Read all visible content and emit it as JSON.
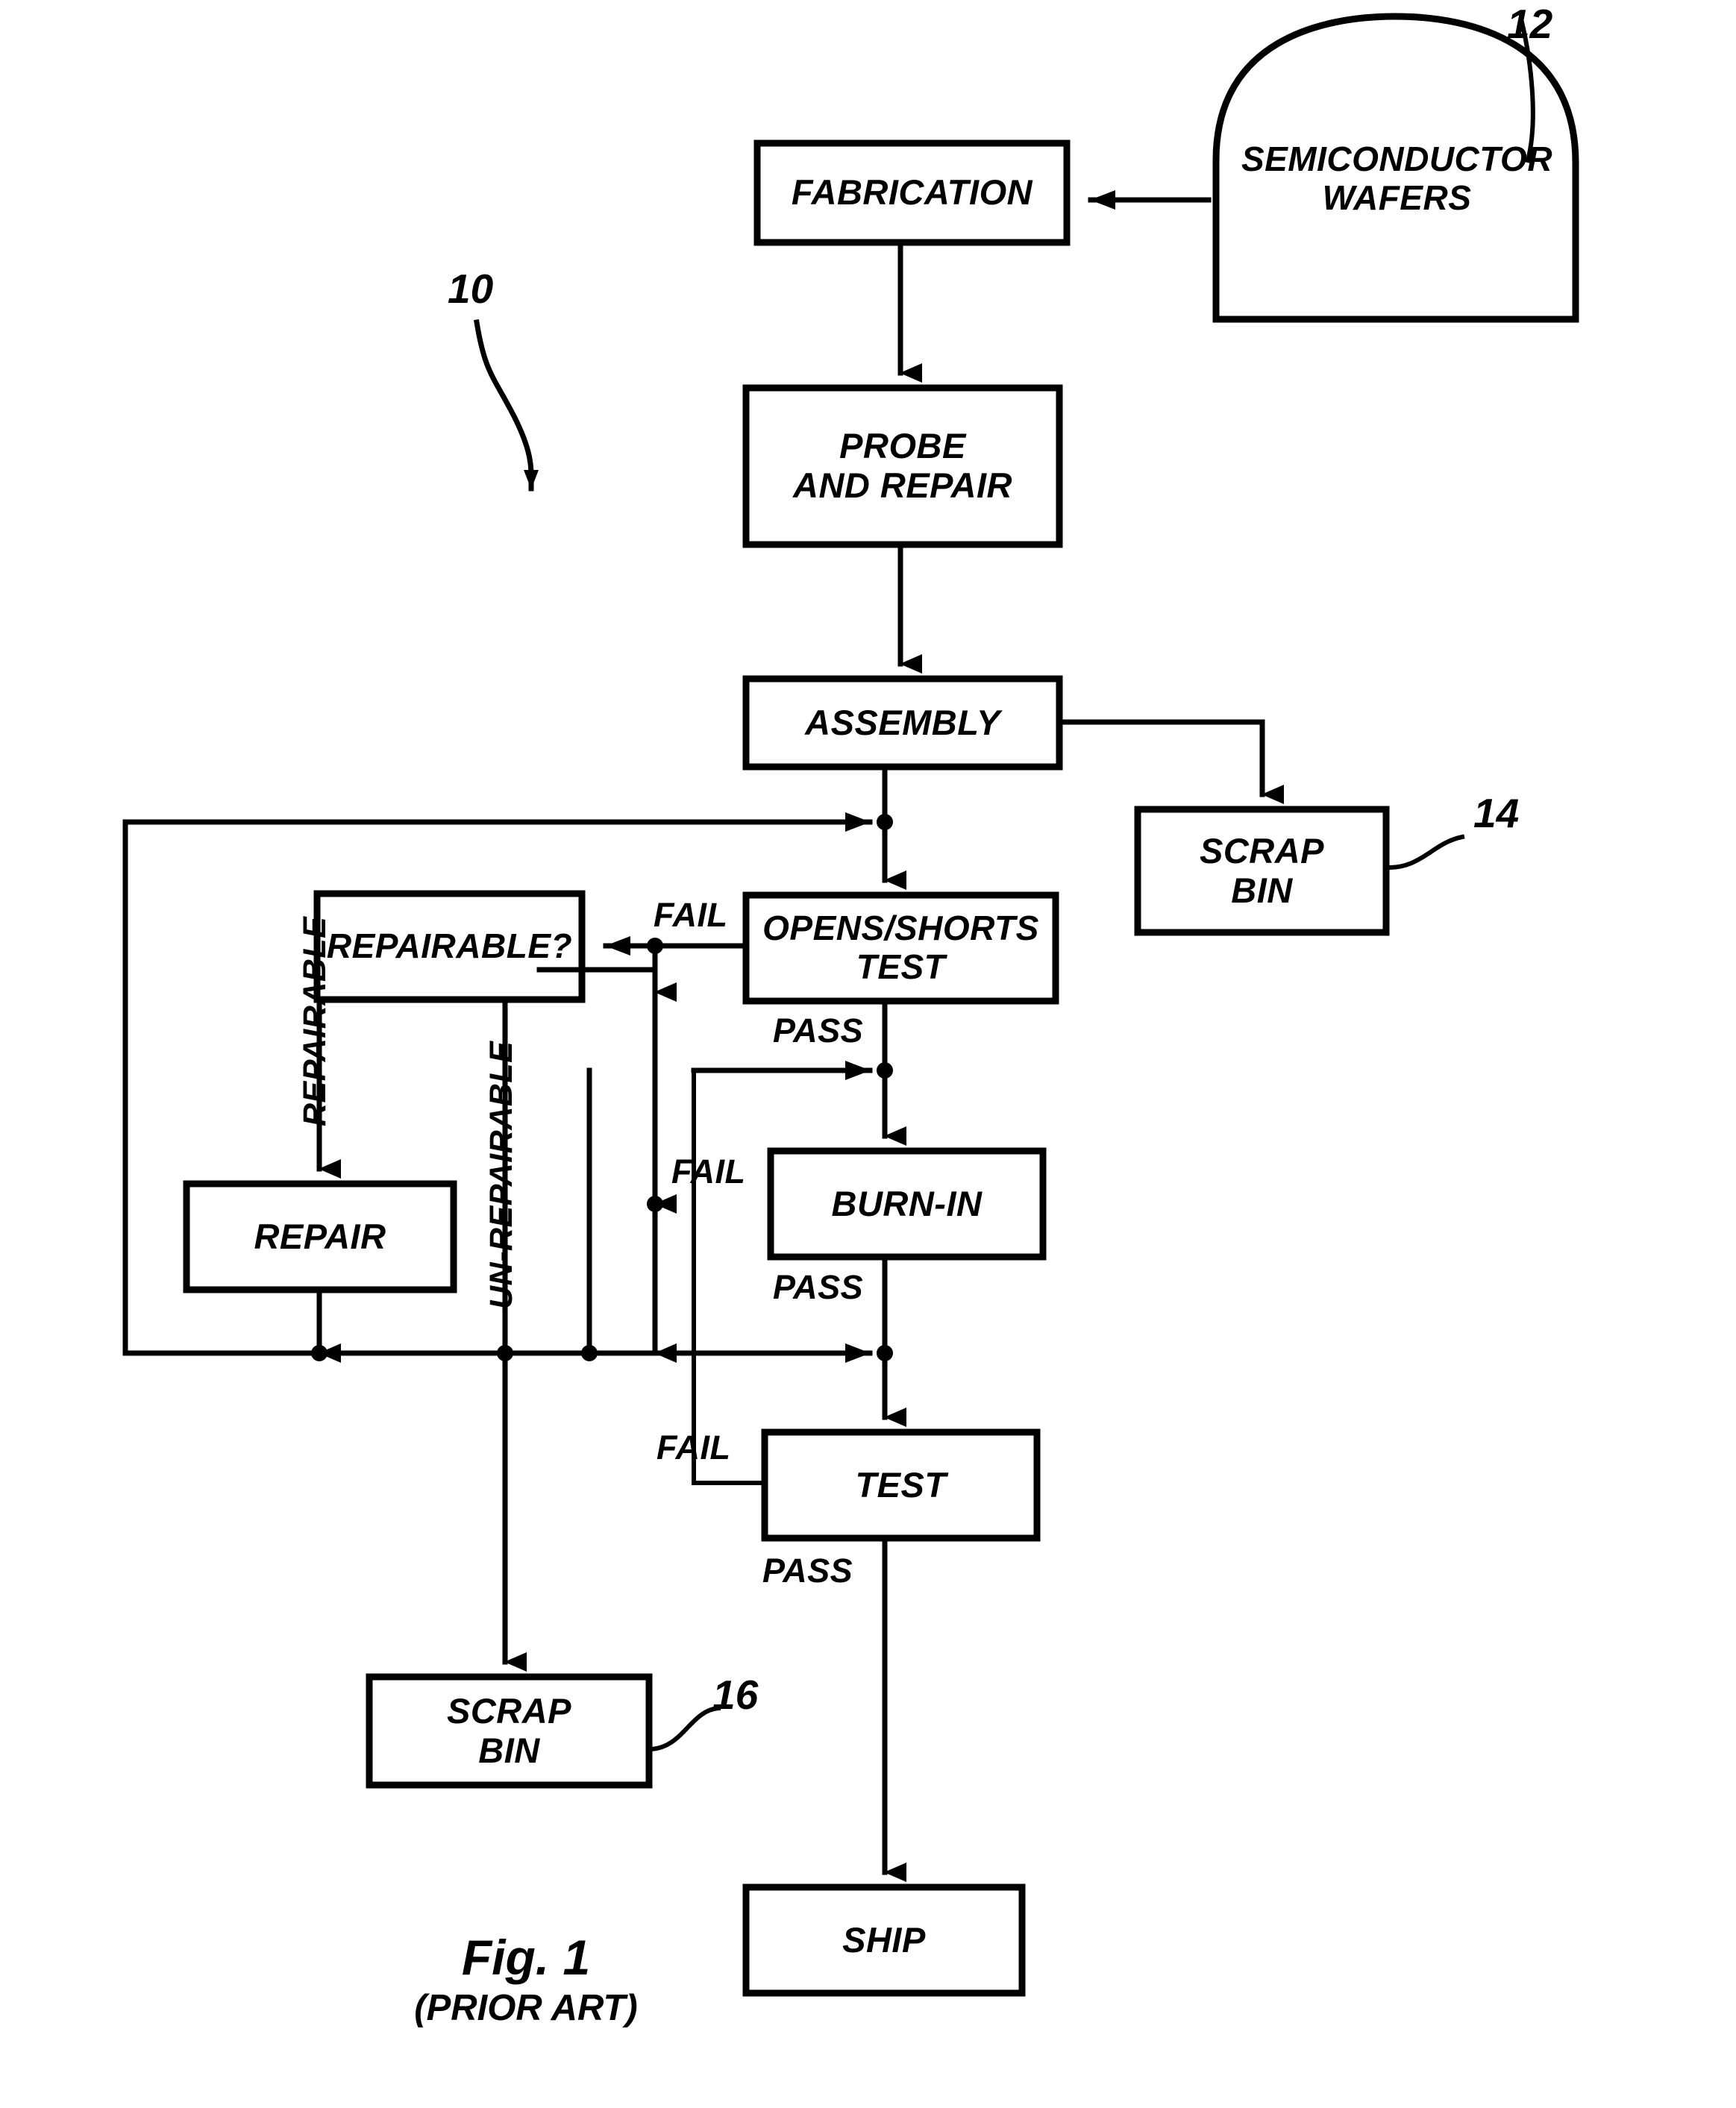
{
  "figure": {
    "title": "Fig. 1",
    "subtitle": "(PRIOR ART)",
    "type": "process-flowchart",
    "description": "Prior art semiconductor memory module manufacturing and test process flow"
  },
  "nodes": {
    "wafers": {
      "label": "SEMICONDUCTOR\nWAFERS",
      "shape": "bullet",
      "font_size": 46
    },
    "fabrication": {
      "label": "FABRICATION",
      "shape": "rect",
      "font_size": 47
    },
    "probe_and_repair": {
      "label": "PROBE\nAND REPAIR",
      "shape": "rect",
      "font_size": 47
    },
    "assembly": {
      "label": "ASSEMBLY",
      "shape": "rect",
      "font_size": 47
    },
    "scrap_bin_14": {
      "label": "SCRAP\nBIN",
      "shape": "rect",
      "font_size": 47
    },
    "opens_shorts_test": {
      "label": "OPENS/SHORTS\nTEST",
      "shape": "rect",
      "font_size": 46
    },
    "repairable": {
      "label": "REPAIRABLE?",
      "shape": "rect",
      "font_size": 46
    },
    "repair": {
      "label": "REPAIR",
      "shape": "rect",
      "font_size": 47
    },
    "burn_in": {
      "label": "BURN-IN",
      "shape": "rect",
      "font_size": 47
    },
    "test": {
      "label": "TEST",
      "shape": "rect",
      "font_size": 47
    },
    "scrap_bin_16": {
      "label": "SCRAP\nBIN",
      "shape": "rect",
      "font_size": 47
    },
    "ship": {
      "label": "SHIP",
      "shape": "rect",
      "font_size": 47
    }
  },
  "edge_labels": {
    "fail_opens_shorts": "FAIL",
    "pass_opens_shorts": "PASS",
    "fail_burn_in": "FAIL",
    "pass_burn_in": "PASS",
    "fail_test": "FAIL",
    "pass_test": "PASS",
    "repairable_branch": "REPAIRABLE",
    "un_repairable_branch": "UN-REPAIRABLE"
  },
  "reference_numerals": {
    "flow": "10",
    "wafers": "12",
    "scrap_bin_assembly": "14",
    "scrap_bin_unrepairable": "16"
  },
  "colors": {
    "ink": "#000000",
    "background": "#ffffff"
  }
}
